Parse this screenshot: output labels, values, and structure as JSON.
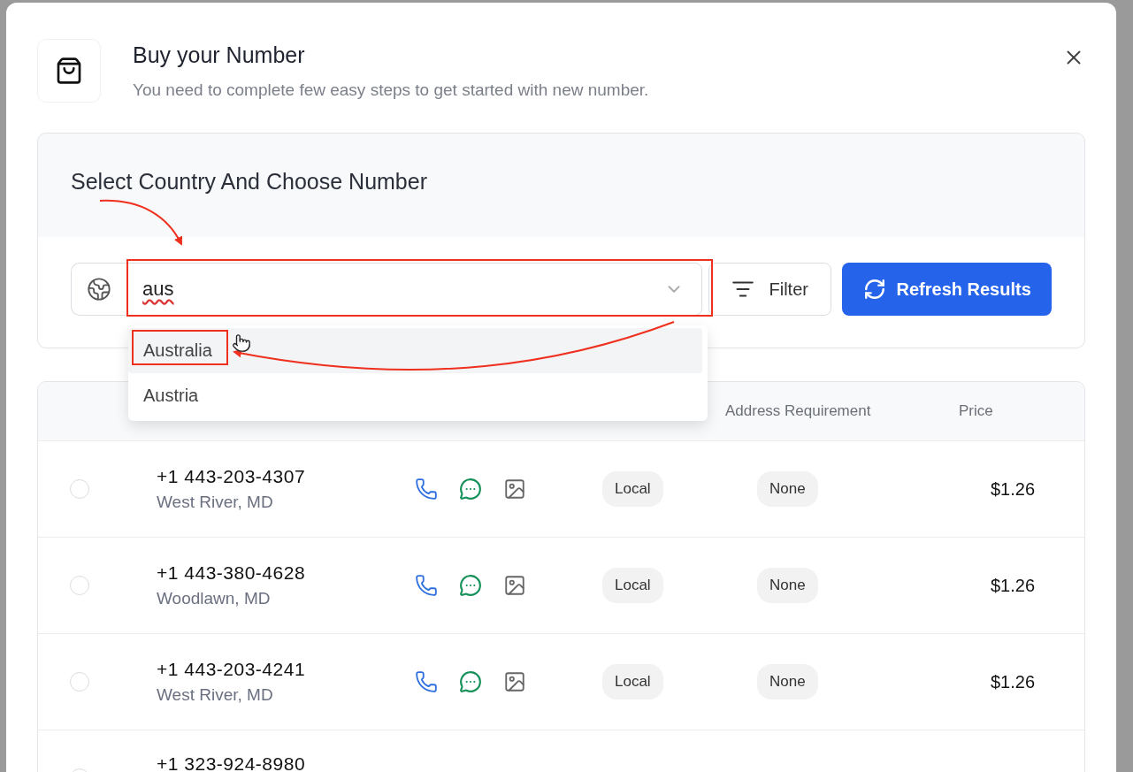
{
  "dialog": {
    "title": "Buy your Number",
    "subtitle": "You need to complete few easy steps to get started with new number."
  },
  "search_card": {
    "title": "Select Country And Choose Number",
    "country_value": "aus",
    "filter_label": "Filter",
    "refresh_label": "Refresh Results"
  },
  "country_options": [
    {
      "label": "Australia",
      "selected": true
    },
    {
      "label": "Austria",
      "selected": false
    }
  ],
  "table": {
    "columns": [
      {
        "label": "Address Requirement"
      },
      {
        "label": "Price"
      }
    ],
    "rows": [
      {
        "number": "+1 443-203-4307",
        "location": "West River, MD",
        "type": "Local",
        "address": "None",
        "price": "$1.26",
        "selected": false
      },
      {
        "number": "+1 443-380-4628",
        "location": "Woodlawn, MD",
        "type": "Local",
        "address": "None",
        "price": "$1.26",
        "selected": false
      },
      {
        "number": "+1 443-203-4241",
        "location": "West River, MD",
        "type": "Local",
        "address": "None",
        "price": "$1.26",
        "selected": false
      },
      {
        "number": "+1 323-924-8980",
        "selected": false
      }
    ]
  }
}
